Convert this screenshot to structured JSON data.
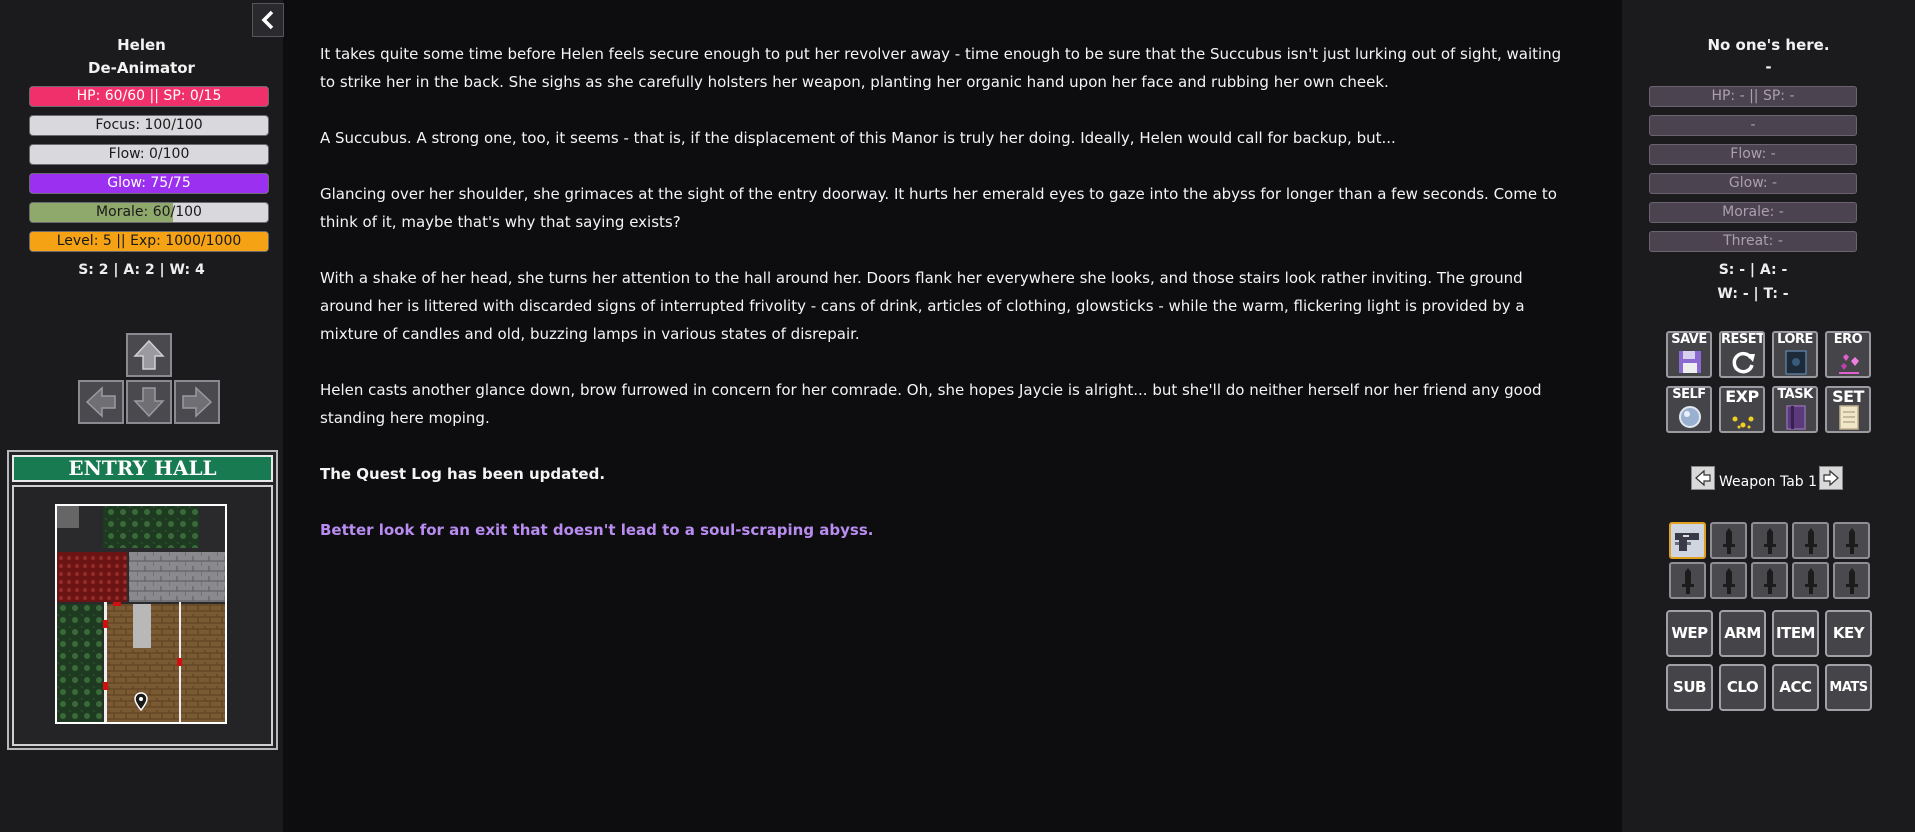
{
  "colors": {
    "hp": "#f0306a",
    "glow": "#9b30f0",
    "morale": "#8fa86c",
    "level": "#f5a314",
    "bar_bg": "#d9d9dd",
    "hint": "#b88cf0",
    "map_header": "#177a50"
  },
  "player": {
    "name": "Helen",
    "class": "De-Animator",
    "bars": {
      "hp": {
        "label": "HP: 60/60 || SP: 0/15",
        "fill": 1.0
      },
      "focus": {
        "label": "Focus: 100/100",
        "fill": 0.0
      },
      "flow": {
        "label": "Flow: 0/100",
        "fill": 0.0
      },
      "glow": {
        "label": "Glow: 75/75",
        "fill": 1.0
      },
      "morale": {
        "label": "Morale: 60/100",
        "fill": 0.6
      },
      "level": {
        "label": "Level: 5 || Exp: 1000/1000",
        "fill": 1.0
      }
    },
    "stats": "S: 2 | A: 2 | W: 4"
  },
  "movement": {
    "up_icon": "arrow-up-icon",
    "left_icon": "arrow-left-icon",
    "down_icon": "arrow-down-icon",
    "right_icon": "arrow-right-icon"
  },
  "map": {
    "title": "ENTRY HALL",
    "player_icon": "location-pin-icon"
  },
  "story": [
    "It takes quite some time before Helen feels secure enough to put her revolver away - time enough to be sure that the Succubus isn't just lurking out of sight, waiting to strike her in the back. She sighs as she carefully holsters her weapon, planting her organic hand upon her face and rubbing her own cheek.",
    "A Succubus. A strong one, too, it seems - that is, if the displacement of this Manor is truly her doing. Ideally, Helen would call for backup, but...",
    "Glancing over her shoulder, she grimaces at the sight of the entry doorway. It hurts her emerald eyes to gaze into the abyss for longer than a few seconds. Come to think of it, maybe that's why that saying exists?",
    "With a shake of her head, she turns her attention to the hall around her. Doors flank her everywhere she looks, and those stairs look rather inviting. The ground around her is littered with discarded signs of interrupted frivolity - cans of drink, articles of clothing, glowsticks - while the warm, flickering light is provided by a mixture of candles and old, buzzing lamps in various states of disrepair.",
    "Helen casts another glance down, brow furrowed in concern for her comrade. Oh, she hopes Jaycie is alright... but she'll do neither herself nor her friend any good standing here moping."
  ],
  "quest_notice": "The Quest Log has been updated.",
  "hint": "Better look for an exit that doesn't lead to a soul-scraping abyss.",
  "enemy": {
    "name": "No one's here.",
    "subtitle": "-",
    "hp": "HP: - || SP: -",
    "focus": "-",
    "flow": "Flow: -",
    "glow": "Glow: -",
    "morale": "Morale: -",
    "threat": "Threat: -",
    "stats1": "S: - | A: -",
    "stats2": "W: - | T: -"
  },
  "menu": [
    {
      "label": "SAVE",
      "icon": "floppy-disk-icon"
    },
    {
      "label": "RESET",
      "icon": "reset-cycle-icon"
    },
    {
      "label": "LORE",
      "icon": "lore-book-icon"
    },
    {
      "label": "ERO",
      "icon": "ero-hearts-icon"
    },
    {
      "label": "SELF",
      "icon": "self-orb-icon"
    },
    {
      "label": "EXP",
      "icon": "exp-sparkles-icon"
    },
    {
      "label": "TASK",
      "icon": "task-journal-icon"
    },
    {
      "label": "SET",
      "icon": "settings-notepad-icon"
    }
  ],
  "weapon_tab": {
    "label": "Weapon Tab 1",
    "prev_icon": "prev-tab-icon",
    "next_icon": "next-tab-icon"
  },
  "weapon_slots": {
    "active_icon": "revolver-icon",
    "empty_icon": "dagger-silhouette-icon"
  },
  "categories": [
    "WEP",
    "ARM",
    "ITEM",
    "KEY",
    "SUB",
    "CLO",
    "ACC",
    "MATS"
  ]
}
